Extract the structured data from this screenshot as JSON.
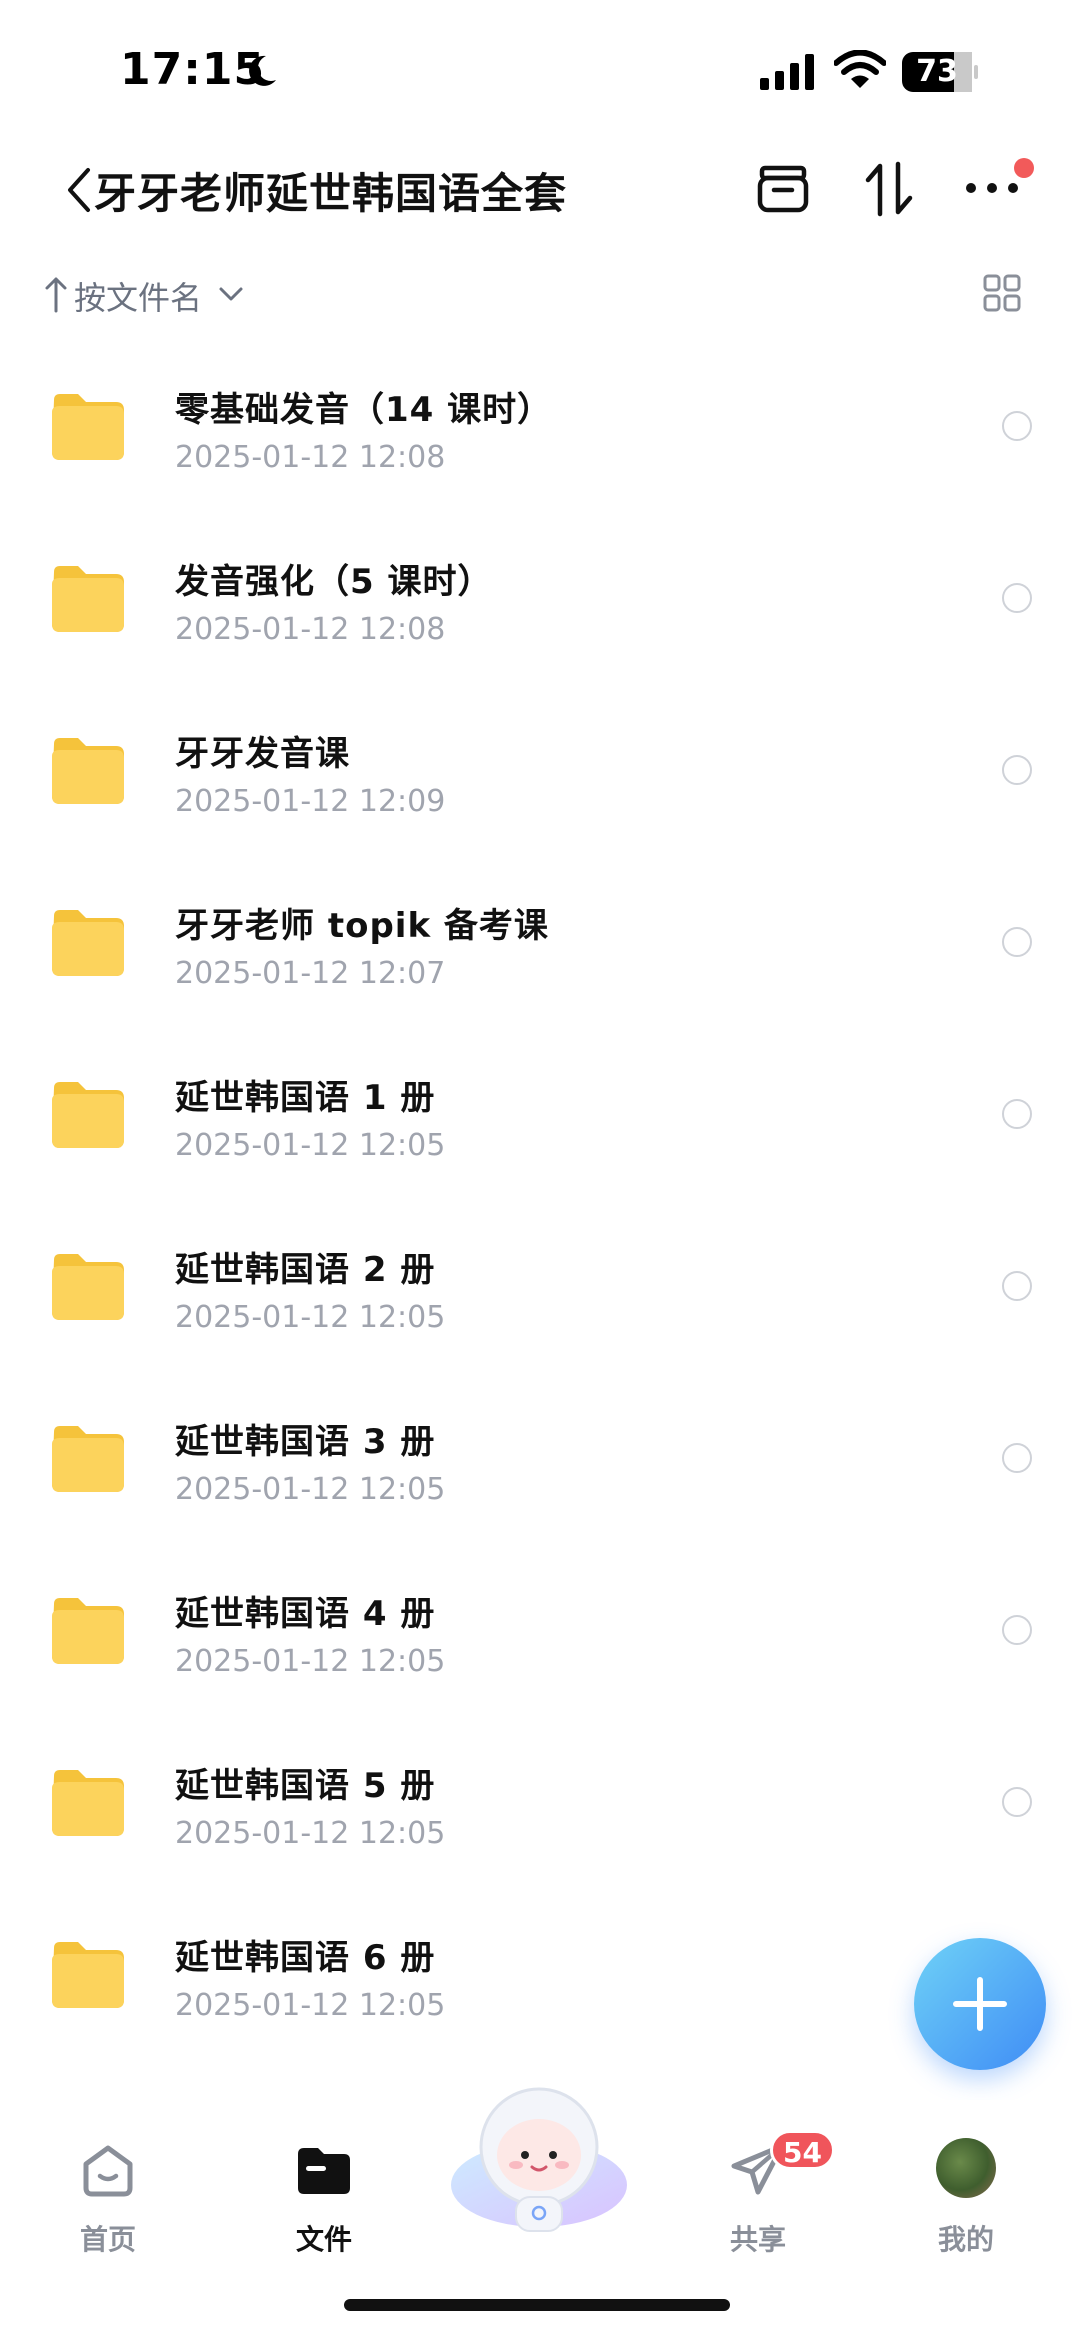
{
  "status_bar": {
    "time": "17:15",
    "battery": "73"
  },
  "header": {
    "title": "牙牙老师延世韩国语全套"
  },
  "sort": {
    "label": "按文件名"
  },
  "files": [
    {
      "name": "零基础发音（14 课时）",
      "date": "2025-01-12 12:08"
    },
    {
      "name": "发音强化（5 课时）",
      "date": "2025-01-12 12:08"
    },
    {
      "name": "牙牙发音课",
      "date": "2025-01-12 12:09"
    },
    {
      "name": "牙牙老师 topik 备考课",
      "date": "2025-01-12 12:07"
    },
    {
      "name": "延世韩国语 1 册",
      "date": "2025-01-12 12:05"
    },
    {
      "name": "延世韩国语 2 册",
      "date": "2025-01-12 12:05"
    },
    {
      "name": "延世韩国语 3 册",
      "date": "2025-01-12 12:05"
    },
    {
      "name": "延世韩国语 4 册",
      "date": "2025-01-12 12:05"
    },
    {
      "name": "延世韩国语 5 册",
      "date": "2025-01-12 12:05"
    },
    {
      "name": "延世韩国语 6 册",
      "date": "2025-01-12 12:05"
    }
  ],
  "tabs": {
    "home": "首页",
    "files": "文件",
    "share": "共享",
    "share_badge": "54",
    "mine": "我的"
  },
  "colors": {
    "accent": "#3f8cf5",
    "badge": "#f0555b",
    "folder": "#f7c948"
  }
}
